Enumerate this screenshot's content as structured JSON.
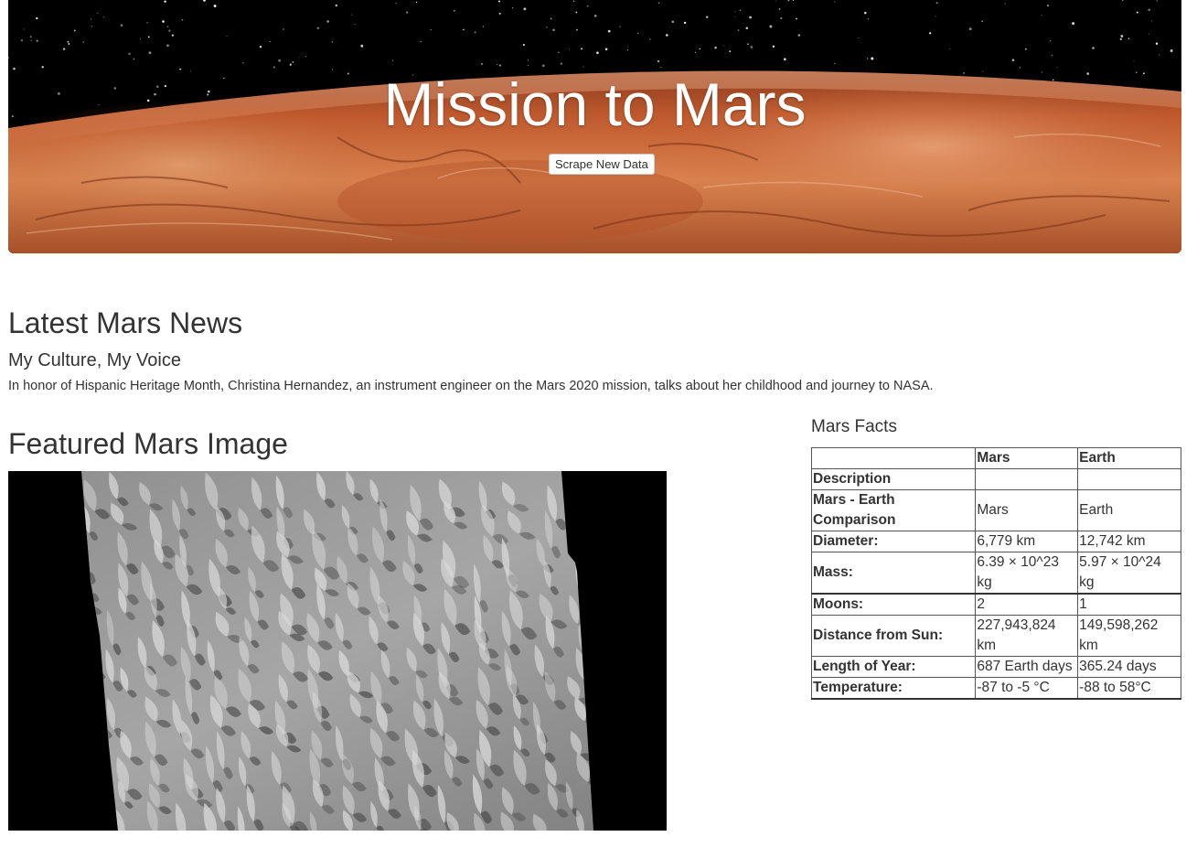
{
  "hero": {
    "title": "Mission to Mars",
    "button_label": "Scrape New Data"
  },
  "news": {
    "heading": "Latest Mars News",
    "title": "My Culture, My Voice",
    "paragraph": "In honor of Hispanic Heritage Month, Christina Hernandez, an instrument engineer on the Mars 2020 mission, talks about her childhood and journey to NASA."
  },
  "featured": {
    "heading": "Featured Mars Image"
  },
  "facts": {
    "heading": "Mars Facts",
    "columns": [
      "",
      "Mars",
      "Earth"
    ],
    "rows": [
      [
        "Description",
        "",
        ""
      ],
      [
        "Mars - Earth Comparison",
        "Mars",
        "Earth"
      ],
      [
        "Diameter:",
        "6,779 km",
        "12,742 km"
      ],
      [
        "Mass:",
        "6.39 × 10^23 kg",
        "5.97 × 10^24 kg"
      ],
      [
        "Moons:",
        "2",
        "1"
      ],
      [
        "Distance from Sun:",
        "227,943,824 km",
        "149,598,262 km"
      ],
      [
        "Length of Year:",
        "687 Earth days",
        "365.24 days"
      ],
      [
        "Temperature:",
        "-87 to -5 °C",
        "-88 to 58°C"
      ]
    ]
  },
  "colors": {
    "mars_surface": "#c8643a",
    "space": "#000000",
    "text": "#333333"
  }
}
